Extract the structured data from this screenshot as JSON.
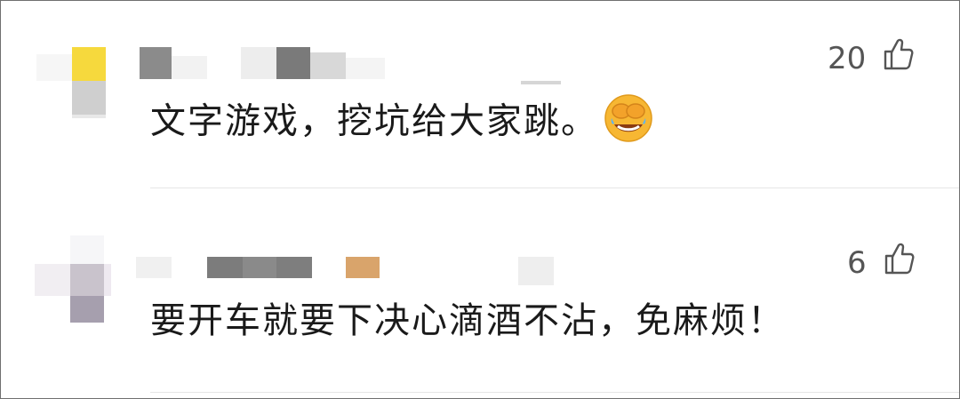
{
  "comments": [
    {
      "text": "文字游戏，挖坑给大家跳。",
      "likes": "20",
      "emoji": "face-palm-laughing-emoji"
    },
    {
      "text": "要开车就要下决心滴酒不沾，免麻烦！",
      "likes": "6"
    }
  ],
  "icons": {
    "like": "thumbs-up-icon"
  },
  "colors": {
    "text": "#1a1a1a",
    "likes": "#555555",
    "divider": "#e6e6e6",
    "emoji_face": "#f7b733"
  }
}
